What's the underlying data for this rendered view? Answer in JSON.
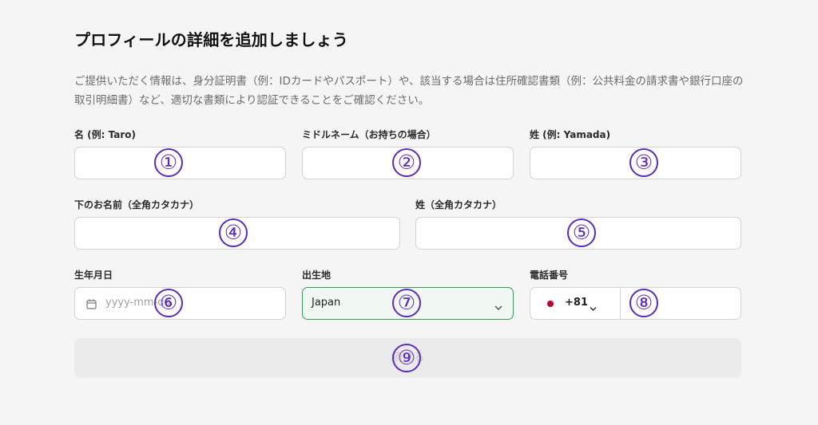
{
  "header": {
    "title": "プロフィールの詳細を追加しましょう",
    "description": "ご提供いただく情報は、身分証明書（例：IDカードやパスポート）や、該当する場合は住所確認書類（例：公共料金の請求書や銀行口座の取引明細書）など、適切な書類により認証できることをご確認ください。"
  },
  "fields": {
    "first_name_label": "名 (例: Taro)",
    "middle_name_label": "ミドルネーム（お持ちの場合）",
    "last_name_label": "姓 (例: Yamada)",
    "first_name_kana_label": "下のお名前（全角カタカナ）",
    "last_name_kana_label": "姓（全角カタカナ）",
    "birthdate_label": "生年月日",
    "birthdate_placeholder": "yyyy-mm-dd",
    "birthplace_label": "出生地",
    "birthplace_value": "Japan",
    "phone_label": "電話番号",
    "phone_country_code": "+81"
  },
  "submit_label": "続ける",
  "badges": [
    "①",
    "②",
    "③",
    "④",
    "⑤",
    "⑥",
    "⑦",
    "⑧",
    "⑨"
  ],
  "colors": {
    "badge": "#5b2bbf",
    "selected_border": "#3a9a5c",
    "flag_red": "#bc002d"
  }
}
